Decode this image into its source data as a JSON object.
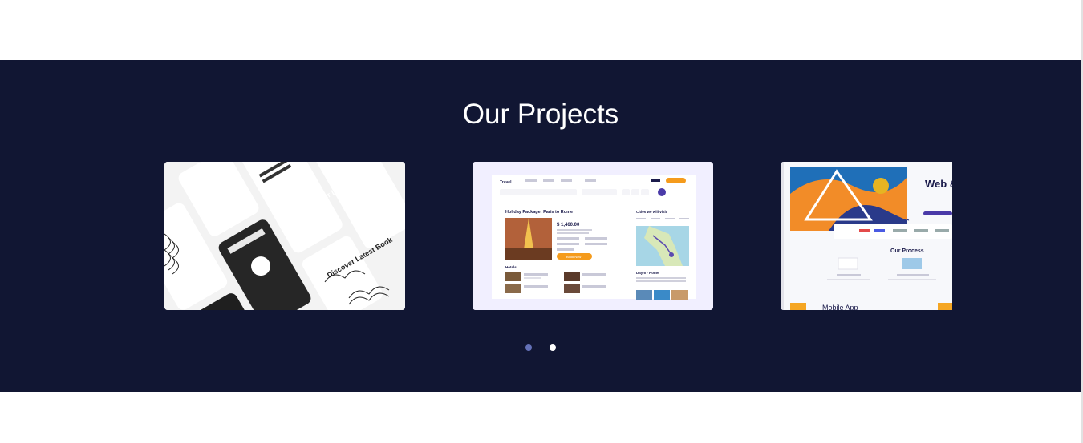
{
  "section": {
    "title": "Our Projects",
    "background_color": "#111633"
  },
  "carousel": {
    "slides": [
      {
        "label_top": "Discover Latest Book",
        "label_bottom": "Discover Latest Book"
      },
      {
        "brand": "Travel",
        "heading": "Holiday Package: Paris to Rome",
        "price": "$ 1,460.00",
        "button": "Book Now",
        "hotels_label": "Hotels",
        "cities_label": "Cities we will visit",
        "day_label": "Day 6 - Rome"
      },
      {
        "hero_text": "Web & Mobile Development",
        "process_label": "Our Process",
        "bottom_text": "Mobile App"
      }
    ],
    "dots": [
      {
        "state": "active",
        "color": "#6471b8"
      },
      {
        "state": "inactive",
        "color": "#ffffff"
      }
    ]
  }
}
